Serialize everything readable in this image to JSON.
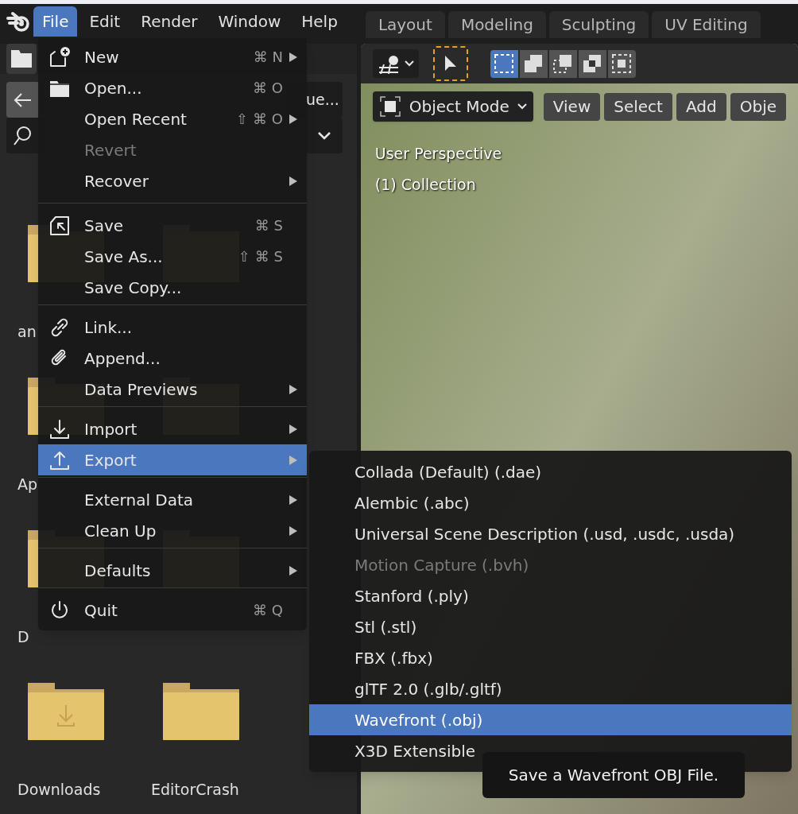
{
  "menubar": [
    {
      "label": "File",
      "selected": true
    },
    {
      "label": "Edit",
      "selected": false
    },
    {
      "label": "Render",
      "selected": false
    },
    {
      "label": "Window",
      "selected": false
    },
    {
      "label": "Help",
      "selected": false
    }
  ],
  "workspace_tabs": [
    "Layout",
    "Modeling",
    "Sculpting",
    "UV Editing"
  ],
  "file_browser": {
    "path_field": "ue...",
    "file_rows": [
      [
        "an"
      ],
      [
        "Ap"
      ],
      [
        "D"
      ],
      [
        "Downloads",
        "EditorCrash"
      ]
    ]
  },
  "viewport": {
    "select_modes": [
      {
        "selected": true
      },
      {
        "selected": false
      },
      {
        "selected": false
      },
      {
        "selected": false
      },
      {
        "selected": false
      }
    ],
    "mode_dropdown": "Object Mode",
    "header_menus": [
      "View",
      "Select",
      "Add",
      "Obje"
    ],
    "overlay_lines": [
      "User Perspective",
      "(1) Collection"
    ]
  },
  "file_menu": [
    [
      {
        "label": "New",
        "shortcut": "⌘ N",
        "submenu": true,
        "disabled": false,
        "selected": false
      },
      {
        "label": "Open...",
        "shortcut": "⌘ O",
        "submenu": false,
        "disabled": false,
        "selected": false
      },
      {
        "label": "Open Recent",
        "shortcut": "⇧ ⌘ O",
        "submenu": true,
        "disabled": false,
        "selected": false
      },
      {
        "label": "Revert",
        "submenu": false,
        "disabled": true,
        "selected": false
      },
      {
        "label": "Recover",
        "submenu": true,
        "disabled": false,
        "selected": false
      }
    ],
    [
      {
        "label": "Save",
        "shortcut": "⌘ S",
        "submenu": false,
        "disabled": false,
        "selected": false
      },
      {
        "label": "Save As...",
        "shortcut": "⇧ ⌘ S",
        "submenu": false,
        "disabled": false,
        "selected": false
      },
      {
        "label": "Save Copy...",
        "submenu": false,
        "disabled": false,
        "selected": false
      }
    ],
    [
      {
        "label": "Link...",
        "submenu": false,
        "disabled": false,
        "selected": false
      },
      {
        "label": "Append...",
        "submenu": false,
        "disabled": false,
        "selected": false
      },
      {
        "label": "Data Previews",
        "submenu": true,
        "disabled": false,
        "selected": false
      }
    ],
    [
      {
        "label": "Import",
        "submenu": true,
        "disabled": false,
        "selected": false
      },
      {
        "label": "Export",
        "submenu": true,
        "disabled": false,
        "selected": true
      }
    ],
    [
      {
        "label": "External Data",
        "submenu": true,
        "disabled": false,
        "selected": false
      },
      {
        "label": "Clean Up",
        "submenu": true,
        "disabled": false,
        "selected": false
      }
    ],
    [
      {
        "label": "Defaults",
        "submenu": true,
        "disabled": false,
        "selected": false
      }
    ],
    [
      {
        "label": "Quit",
        "shortcut": "⌘ Q",
        "submenu": false,
        "disabled": false,
        "selected": false
      }
    ]
  ],
  "export_submenu": [
    {
      "label": "Collada (Default) (.dae)",
      "disabled": false,
      "selected": false
    },
    {
      "label": "Alembic (.abc)",
      "disabled": false,
      "selected": false
    },
    {
      "label": "Universal Scene Description (.usd, .usdc, .usda)",
      "disabled": false,
      "selected": false
    },
    {
      "label": "Motion Capture (.bvh)",
      "disabled": true,
      "selected": false
    },
    {
      "label": "Stanford (.ply)",
      "disabled": false,
      "selected": false
    },
    {
      "label": "Stl (.stl)",
      "disabled": false,
      "selected": false
    },
    {
      "label": "FBX (.fbx)",
      "disabled": false,
      "selected": false
    },
    {
      "label": "glTF 2.0 (.glb/.gltf)",
      "disabled": false,
      "selected": false
    },
    {
      "label": "Wavefront (.obj)",
      "disabled": false,
      "selected": true
    },
    {
      "label": "X3D Extensible",
      "disabled": false,
      "selected": false
    }
  ],
  "tooltip": "Save a Wavefront OBJ File."
}
